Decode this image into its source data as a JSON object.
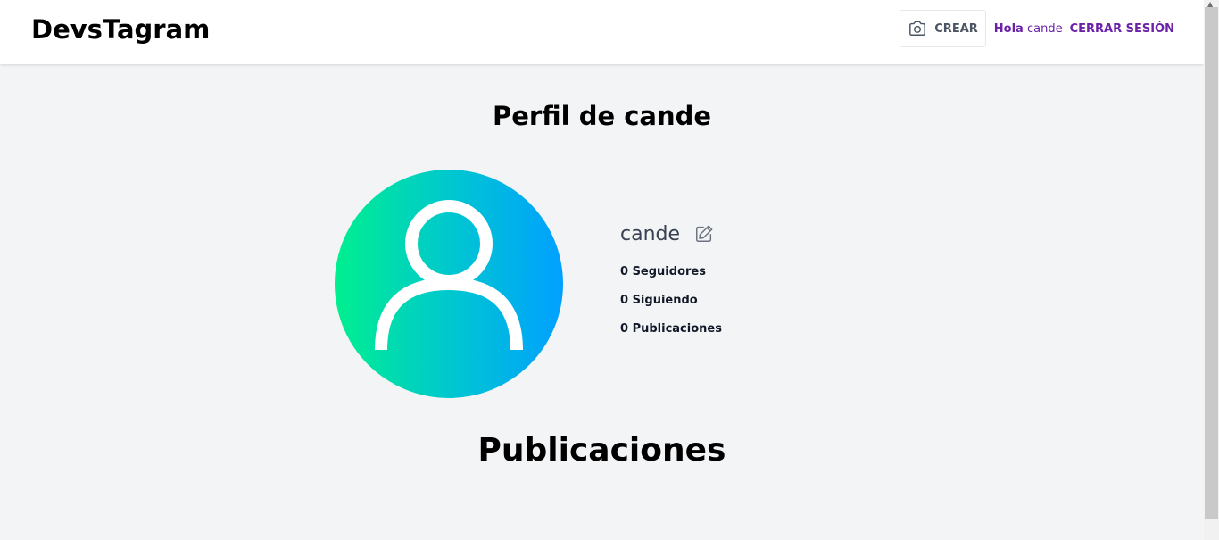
{
  "header": {
    "logo": "DevsTagram",
    "create_label": "CREAR",
    "greeting_prefix": "Hola",
    "greeting_user": "cande",
    "logout_label": "CERRAR SESIÓN"
  },
  "profile": {
    "title": "Perfil de cande",
    "username": "cande",
    "followers": "0 Seguidores",
    "following": "0 Siguiendo",
    "posts": "0 Publicaciones"
  },
  "posts_section": {
    "title": "Publicaciones"
  },
  "icons": {
    "create": "camera-icon",
    "edit": "pencil-square-icon",
    "avatar": "user-icon"
  },
  "colors": {
    "accent": "#6b21a8",
    "avatar_gradient_start": "#00ef8f",
    "avatar_gradient_end": "#00a0ff",
    "background": "#f3f4f6"
  }
}
